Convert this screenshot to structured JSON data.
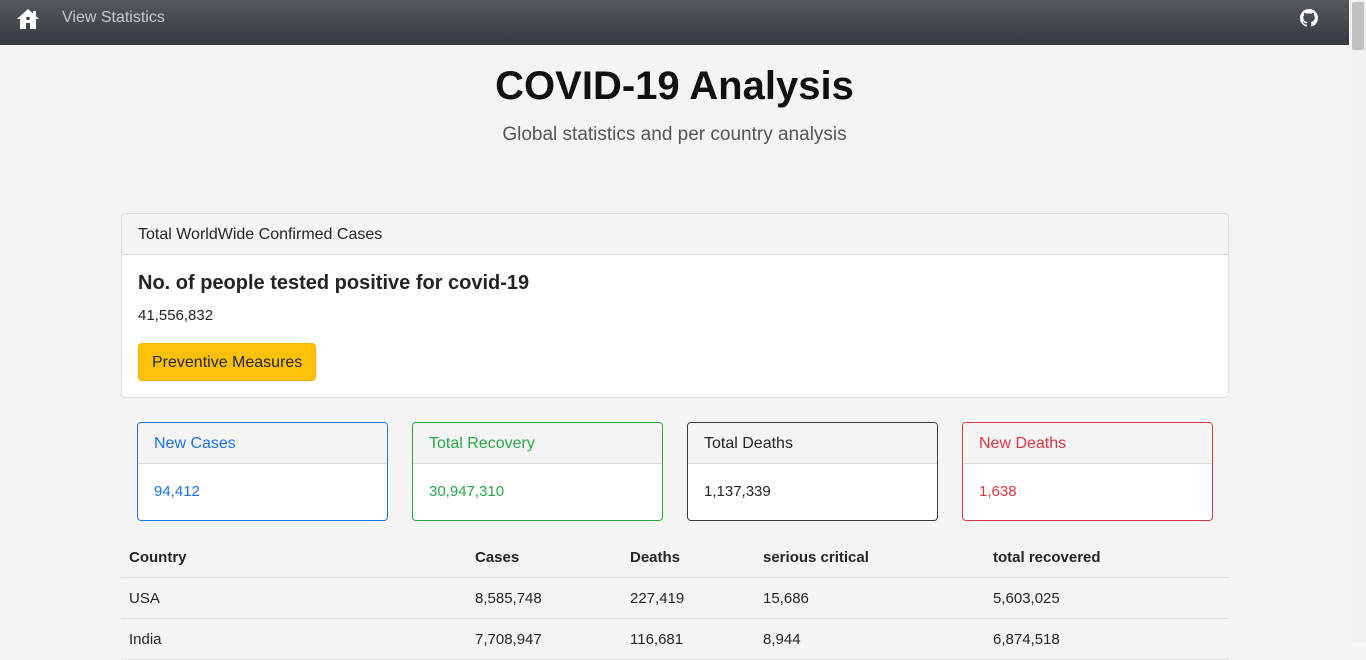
{
  "nav": {
    "link_label": "View Statistics",
    "home_icon": "home-icon",
    "github_icon": "github-icon"
  },
  "header": {
    "title": "COVID-19 Analysis",
    "subtitle": "Global statistics and per country analysis"
  },
  "main_card": {
    "header": "Total WorldWide Confirmed Cases",
    "title": "No. of people tested positive for covid-19",
    "value": "41,556,832",
    "button_label": "Preventive Measures"
  },
  "stats": {
    "new_cases": {
      "label": "New Cases",
      "value": "94,412",
      "color": "#1a73e8"
    },
    "total_recovery": {
      "label": "Total Recovery",
      "value": "30,947,310",
      "color": "#28a745"
    },
    "total_deaths": {
      "label": "Total Deaths",
      "value": "1,137,339",
      "color": "#343a40"
    },
    "new_deaths": {
      "label": "New Deaths",
      "value": "1,638",
      "color": "#dc3545"
    }
  },
  "table": {
    "columns": [
      "Country",
      "Cases",
      "Deaths",
      "serious critical",
      "total recovered"
    ],
    "rows": [
      [
        "USA",
        "8,585,748",
        "227,419",
        "15,686",
        "5,603,025"
      ],
      [
        "India",
        "7,708,947",
        "116,681",
        "8,944",
        "6,874,518"
      ]
    ]
  }
}
